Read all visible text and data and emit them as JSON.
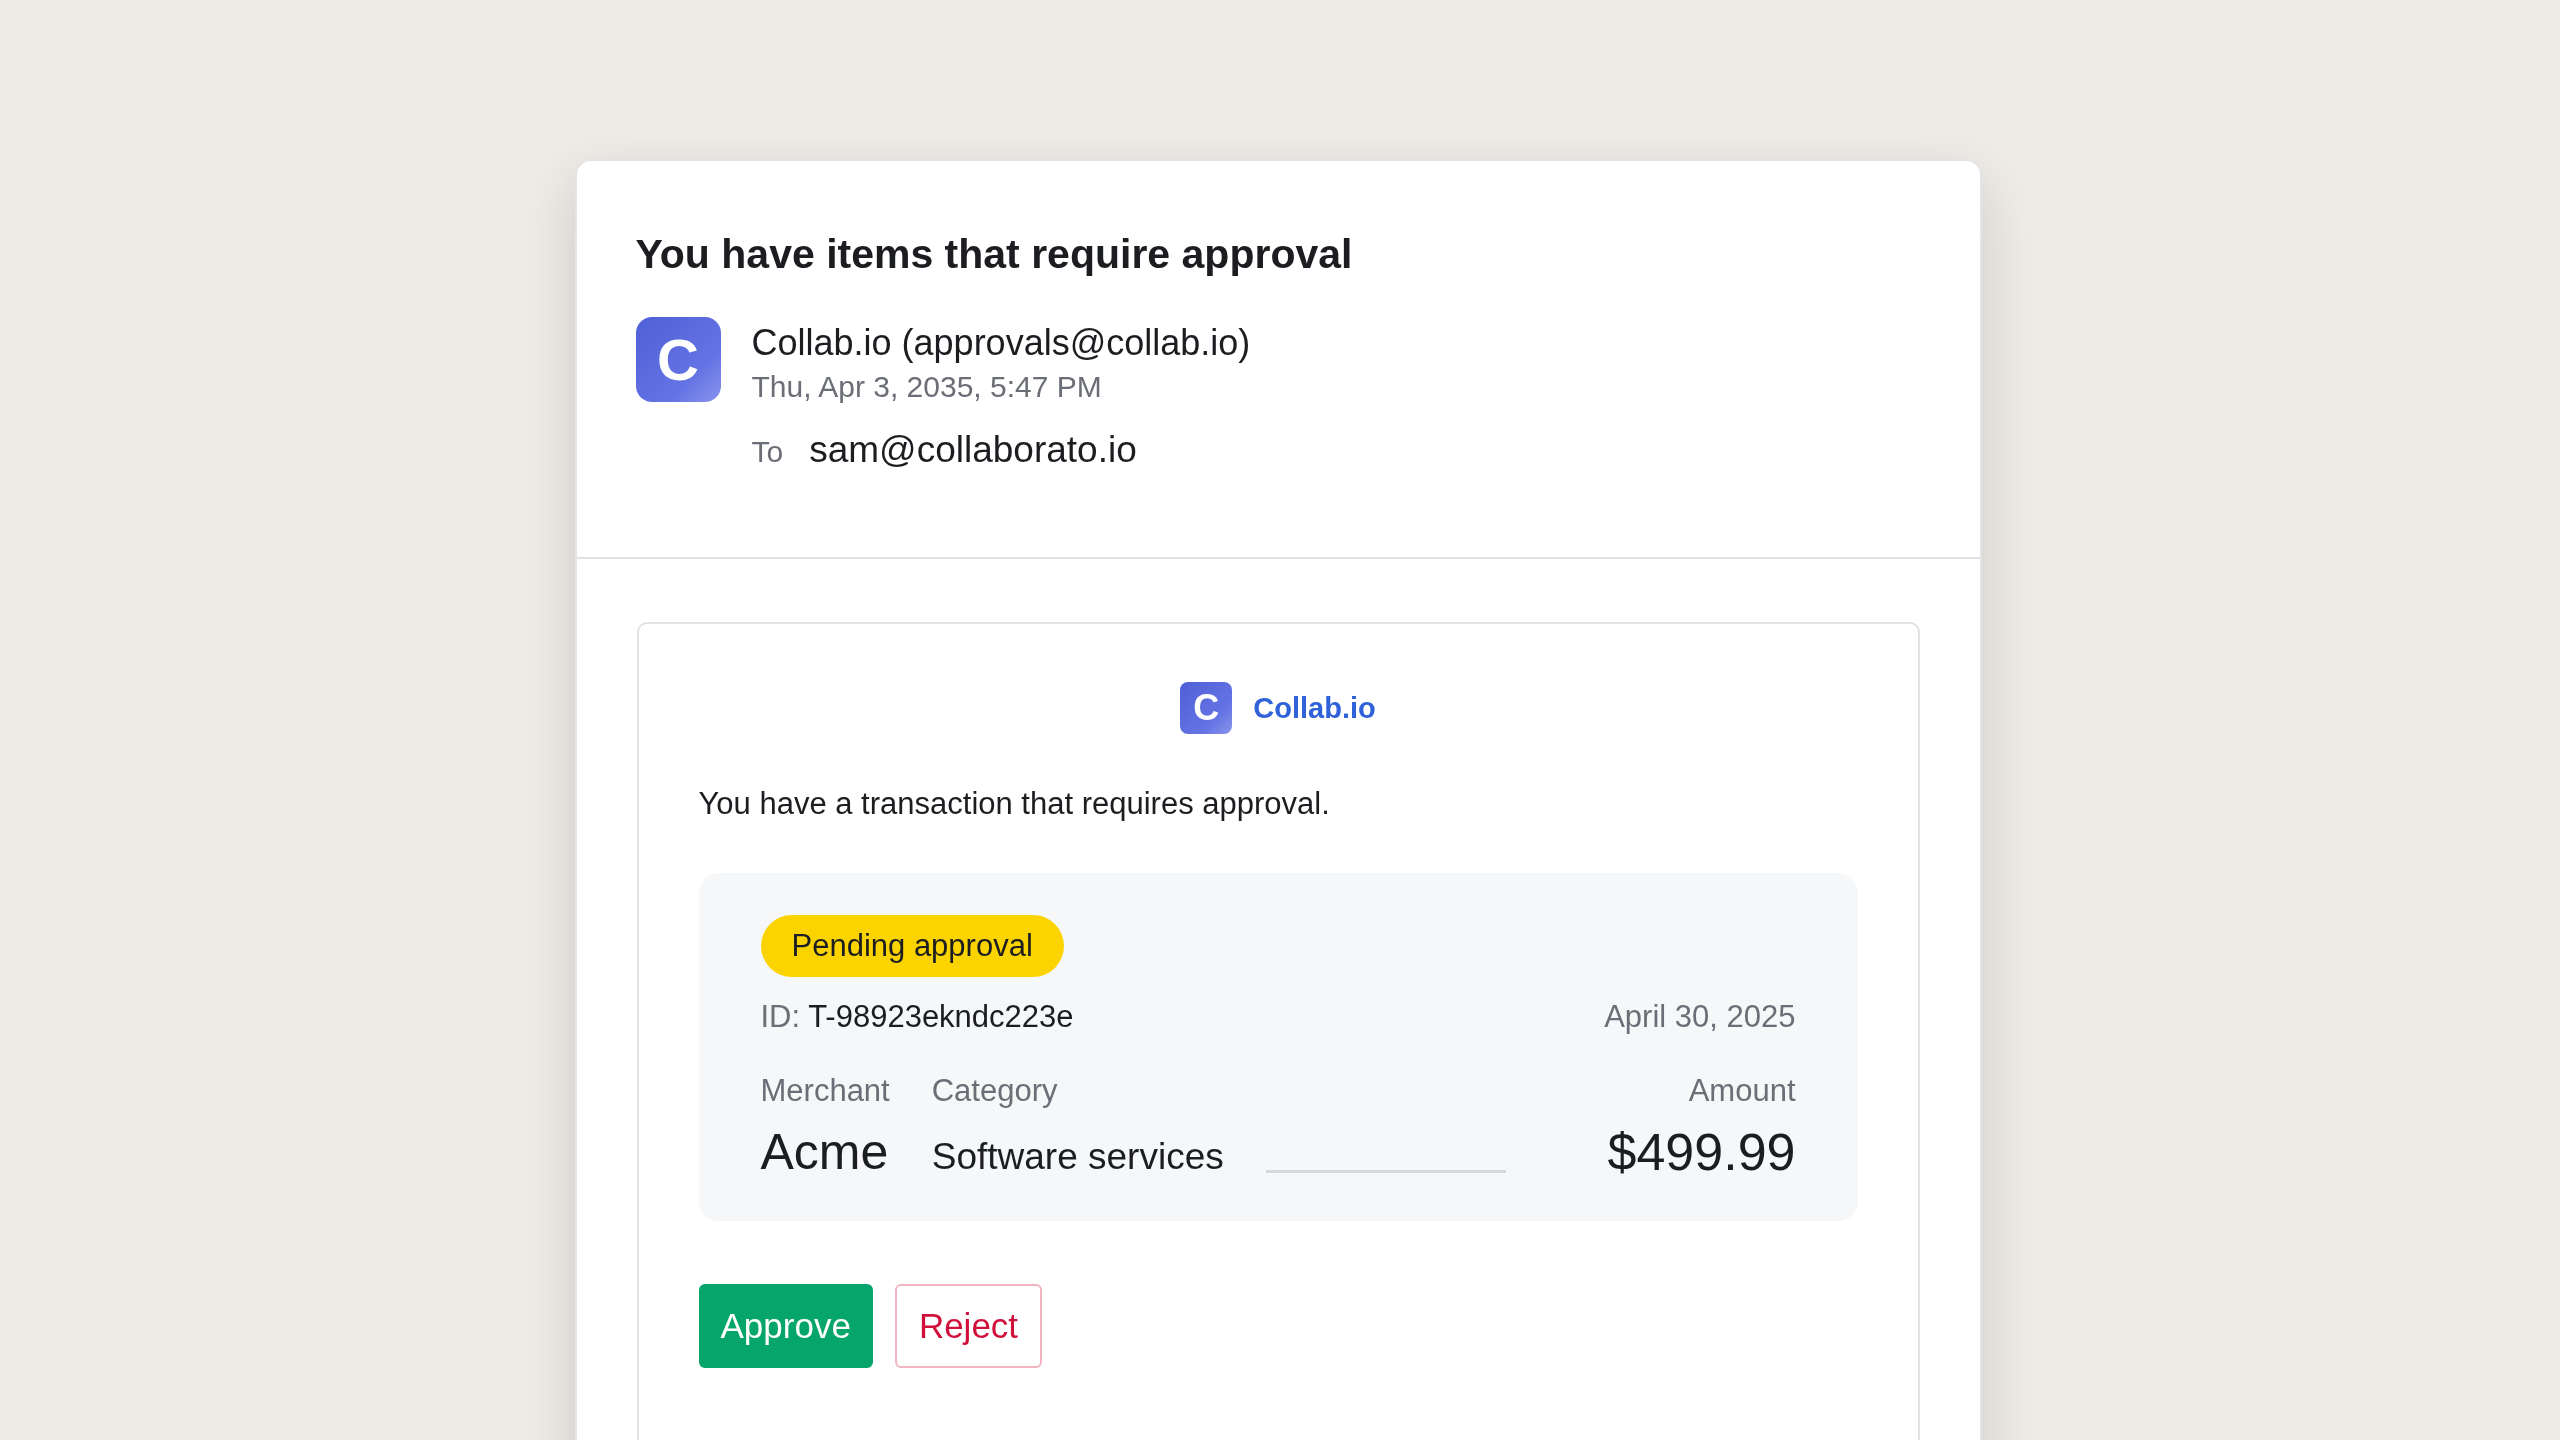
{
  "email": {
    "subject": "You have items that require approval",
    "sender": {
      "avatar_letter": "C",
      "from": "Collab.io (approvals@collab.io)",
      "date": "Thu, Apr 3, 2035, 5:47 PM",
      "to_label": "To",
      "to": "sam@collaborato.io"
    }
  },
  "message": {
    "brand": {
      "logo_letter": "C",
      "name": "Collab.io"
    },
    "intro": "You have a transaction that requires approval.",
    "transaction": {
      "status": "Pending approval",
      "id_label": "ID:",
      "id": "T-98923ekndc223e",
      "date": "April 30, 2025",
      "columns": [
        "Merchant",
        "Category",
        "Amount"
      ],
      "merchant": "Acme",
      "category": "Software services",
      "amount": "$499.99"
    },
    "buttons": [
      {
        "label": "Approve",
        "kind": "primary"
      },
      {
        "label": "Reject",
        "kind": "danger"
      }
    ]
  }
}
